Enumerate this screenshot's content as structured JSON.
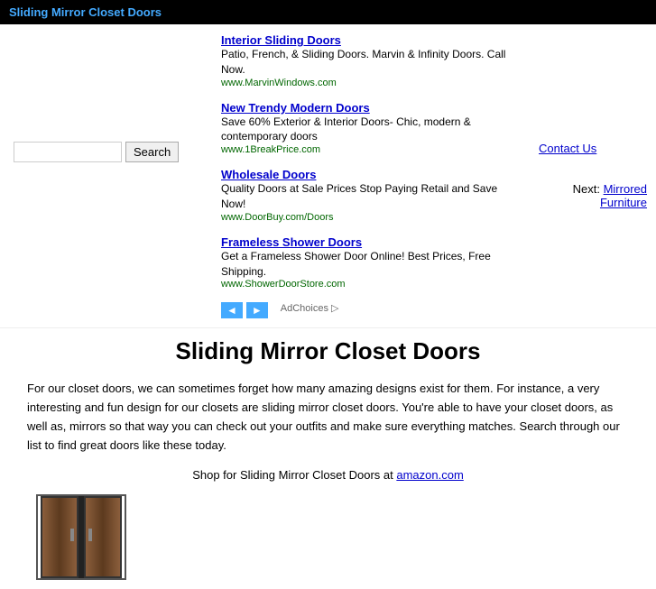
{
  "header": {
    "title": "Sliding Mirror Closet Doors",
    "link_text": "Sliding Mirror Closet Doors"
  },
  "search": {
    "button_label": "Search",
    "placeholder": ""
  },
  "ads": [
    {
      "title": "Interior Sliding Doors",
      "description": "Patio, French, & Sliding Doors. Marvin & Infinity Doors. Call Now.",
      "url": "www.MarvinWindows.com"
    },
    {
      "title": "New Trendy Modern Doors",
      "description": "Save 60% Exterior & Interior Doors- Chic, modern & contemporary doors",
      "url": "www.1BreakPrice.com"
    },
    {
      "title": "Wholesale Doors",
      "description": "Quality Doors at Sale Prices Stop Paying Retail and Save Now!",
      "url": "www.DoorBuy.com/Doors"
    },
    {
      "title": "Frameless Shower Doors",
      "description": "Get a Frameless Shower Door Online! Best Prices, Free Shipping.",
      "url": "www.ShowerDoorStore.com"
    }
  ],
  "ad_nav": {
    "prev": "◄",
    "next": "►"
  },
  "ad_choices_label": "AdChoices ▷",
  "contact_us": "Contact Us",
  "next_label": "Next:",
  "next_link": "Mirrored Furniture",
  "page": {
    "heading": "Sliding Mirror Closet Doors",
    "description": "For our closet doors, we can sometimes forget how many amazing designs exist for them. For instance, a very interesting and fun design for our closets are sliding mirror closet doors. You're able to have your closet doors, as well as, mirrors so that way you can check out your outfits and make sure everything matches. Search through our list to find great doors like these today.",
    "shop_prefix": "Shop for Sliding Mirror Closet Doors at",
    "shop_link_text": "amazon.com",
    "shop_link_url": "https://www.amazon.com"
  }
}
